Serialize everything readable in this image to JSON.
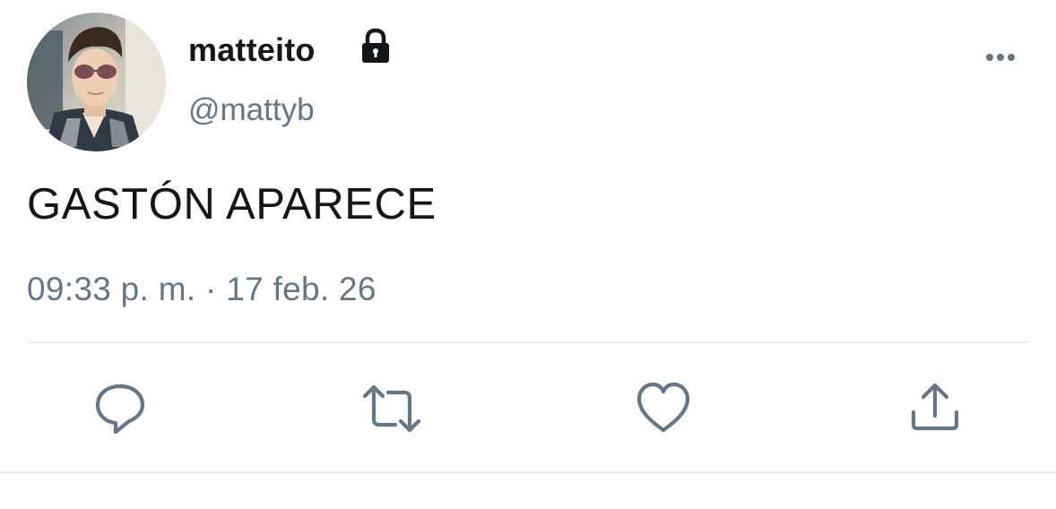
{
  "tweet": {
    "display_name": "matteito",
    "handle": "@mattyb",
    "protected_icon": "lock-icon",
    "text": "GASTÓN APARECE",
    "timestamp": "09:33 p. m. · 17 feb. 26"
  },
  "header": {
    "more_icon": "more-horizontal-icon"
  },
  "actions": [
    {
      "name": "reply",
      "icon": "reply-icon"
    },
    {
      "name": "retweet",
      "icon": "retweet-icon"
    },
    {
      "name": "like",
      "icon": "heart-icon"
    },
    {
      "name": "share",
      "icon": "share-icon"
    }
  ],
  "colors": {
    "text_primary": "#14171a",
    "text_secondary": "#657786",
    "icon": "#657786",
    "divider": "#e6ecf0",
    "background": "#ffffff"
  }
}
